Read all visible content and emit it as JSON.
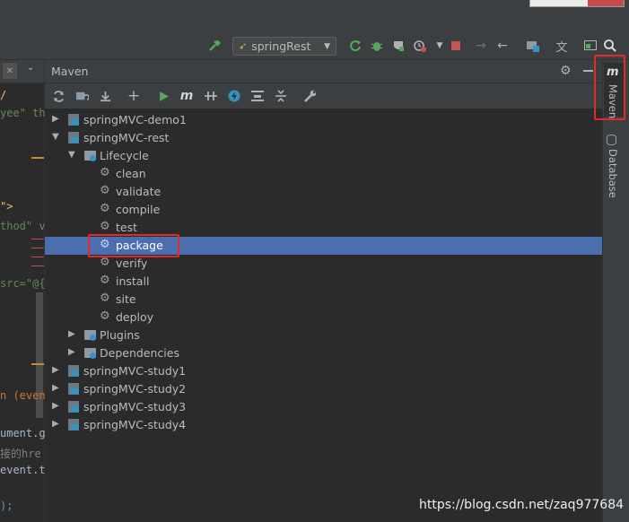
{
  "toolbar": {
    "run_config": "springRest"
  },
  "editor": {
    "code_lines": [
      {
        "text": "yee\" th",
        "kind": "mixed"
      },
      {
        "text": "\">",
        "kind": "tag"
      },
      {
        "text": "thod\" v",
        "kind": "mixed"
      },
      {
        "text": "src=\"@{",
        "kind": "mixed"
      },
      {
        "text": "n (even",
        "kind": "fn"
      },
      {
        "text": "ument.g",
        "kind": "id"
      },
      {
        "text": "接的hre",
        "kind": "cmt"
      },
      {
        "text": "event.t",
        "kind": "id"
      },
      {
        "text": ");",
        "kind": "id"
      }
    ]
  },
  "maven": {
    "title": "Maven",
    "tree": [
      {
        "label": "springMVC-demo1",
        "type": "project",
        "expanded": false
      },
      {
        "label": "springMVC-rest",
        "type": "project",
        "expanded": true
      },
      {
        "label": "Lifecycle",
        "type": "folder",
        "expanded": true
      },
      {
        "label": "clean",
        "type": "goal"
      },
      {
        "label": "validate",
        "type": "goal"
      },
      {
        "label": "compile",
        "type": "goal"
      },
      {
        "label": "test",
        "type": "goal"
      },
      {
        "label": "package",
        "type": "goal",
        "selected": true
      },
      {
        "label": "verify",
        "type": "goal"
      },
      {
        "label": "install",
        "type": "goal"
      },
      {
        "label": "site",
        "type": "goal"
      },
      {
        "label": "deploy",
        "type": "goal"
      },
      {
        "label": "Plugins",
        "type": "folder",
        "expanded": false
      },
      {
        "label": "Dependencies",
        "type": "folder",
        "expanded": false
      },
      {
        "label": "springMVC-study1",
        "type": "project",
        "expanded": false
      },
      {
        "label": "springMVC-study2",
        "type": "project",
        "expanded": false
      },
      {
        "label": "springMVC-study3",
        "type": "project",
        "expanded": false
      },
      {
        "label": "springMVC-study4",
        "type": "project",
        "expanded": false
      }
    ]
  },
  "side_tabs": {
    "maven_label": "Maven",
    "maven_icon": "m",
    "database_label": "Database"
  },
  "watermark": "https://blog.csdn.net/zaq977684",
  "colors": {
    "selection": "#4b6eaf",
    "highlight_box": "#e32a2a",
    "run_green": "#499c54",
    "stop_red": "#c75450"
  }
}
